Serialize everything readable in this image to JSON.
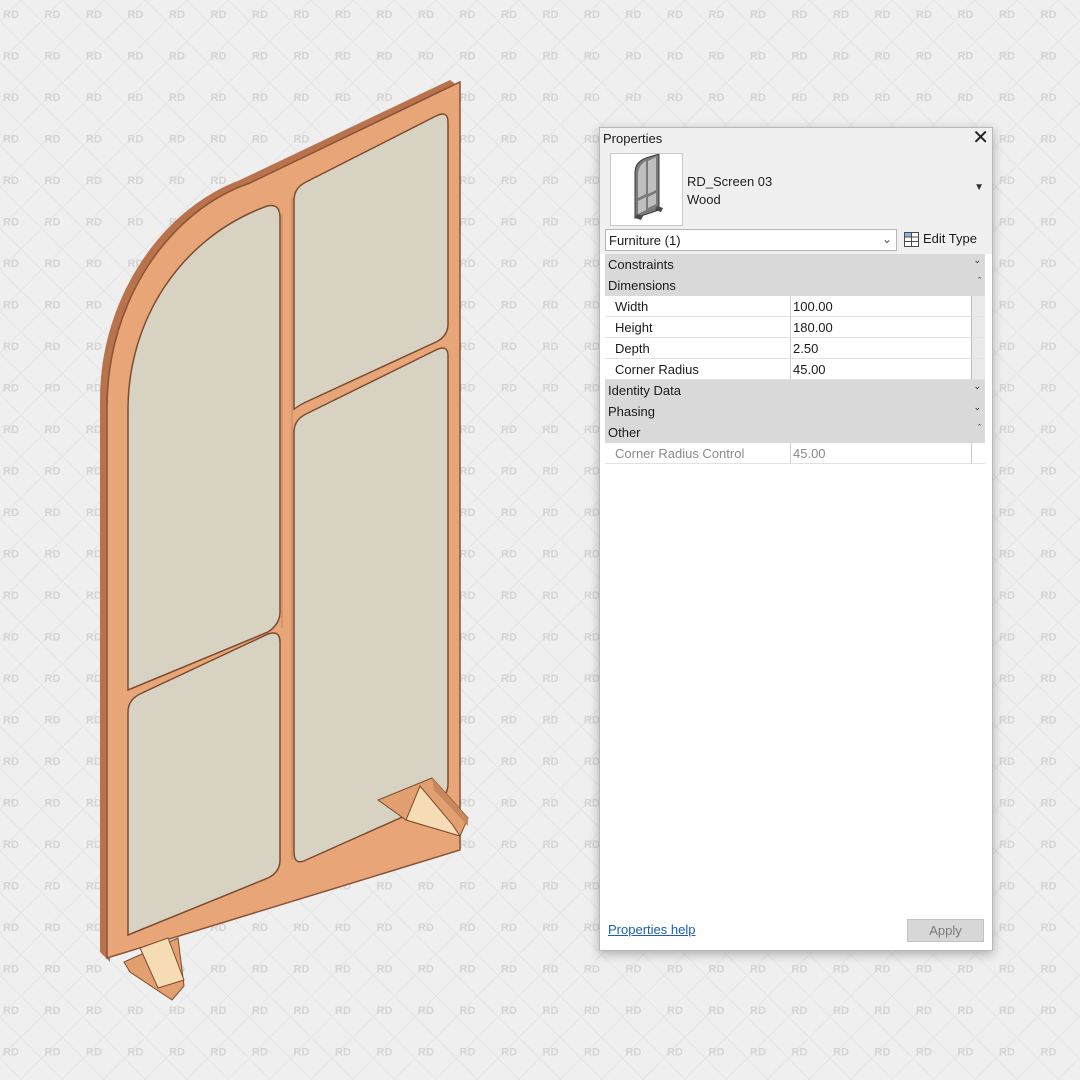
{
  "watermark": {
    "text": "RD"
  },
  "colors": {
    "background": "#efefef",
    "wood": "#e8a577",
    "wood_dark": "#c47f56",
    "panel": "#d8d2c3",
    "group_header": "#d9d9d9",
    "link": "#1a5fb4"
  },
  "properties": {
    "title": "Properties",
    "close_icon": "close-icon",
    "type_selector": {
      "family": "RD_Screen 03",
      "type": "Wood"
    },
    "filter": {
      "value": "Furniture (1)"
    },
    "edit_type_label": "Edit Type",
    "groups": {
      "constraints": {
        "label": "Constraints",
        "collapsed": true
      },
      "dimensions": {
        "label": "Dimensions",
        "collapsed": false,
        "params": [
          {
            "name": "Width",
            "value": "100.00"
          },
          {
            "name": "Height",
            "value": "180.00"
          },
          {
            "name": "Depth",
            "value": "2.50"
          },
          {
            "name": "Corner Radius",
            "value": "45.00"
          }
        ]
      },
      "identity": {
        "label": "Identity Data",
        "collapsed": true
      },
      "phasing": {
        "label": "Phasing",
        "collapsed": true
      },
      "other": {
        "label": "Other",
        "collapsed": false,
        "params": [
          {
            "name": "Corner Radius Control",
            "value": "45.00",
            "disabled": true
          }
        ]
      }
    },
    "help_link": "Properties help",
    "apply_label": "Apply"
  }
}
